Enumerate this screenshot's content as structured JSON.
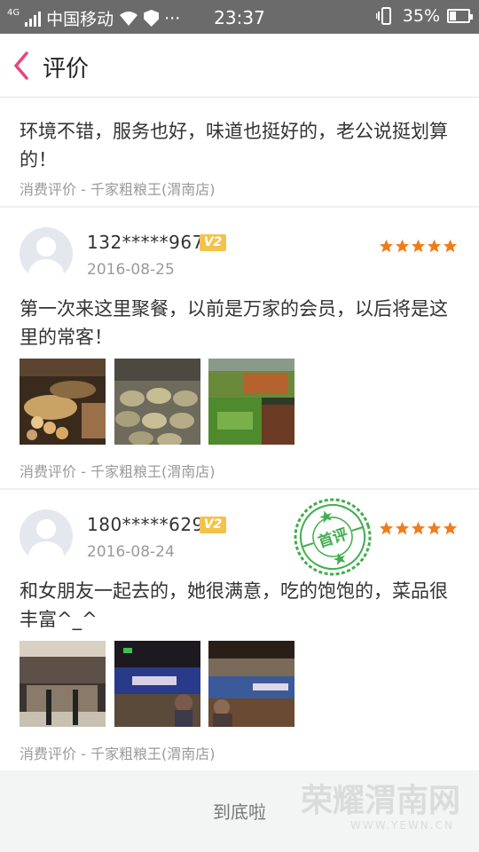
{
  "status_bar": {
    "network": "4G",
    "carrier": "中国移动",
    "more": "···",
    "time": "23:37",
    "battery": "35%",
    "battery_level": 0.35
  },
  "header": {
    "title": "评价"
  },
  "reviews": [
    {
      "content_lines": [
        "环境不错，服务也好，味道也挺好的，老公说挺划算",
        "的！"
      ],
      "meta": "消费评价 - 千家粗粮王(渭南店)"
    },
    {
      "user": "132*****967",
      "vip": "V2",
      "date": "2016-08-25",
      "rating": 5,
      "content_lines": [
        "第一次来这里聚餐，以前是万家的会员，以后将是这",
        "里的常客！"
      ],
      "meta": "消费评价 - 千家粗粮王(渭南店)"
    },
    {
      "user": "180*****629",
      "vip": "V2",
      "date": "2016-08-24",
      "rating": 5,
      "badge": "首评",
      "content_lines": [
        "和女朋友一起去的，她很满意，吃的饱饱的，菜品很",
        "丰富^_^"
      ],
      "meta": "消费评价 - 千家粗粮王(渭南店)"
    }
  ],
  "footer": {
    "text": "到底啦"
  },
  "watermark": {
    "main": "荣耀渭南网",
    "sub": "WWW.YEWN.CN"
  },
  "colors": {
    "accent": "#e8457c",
    "star": "#f07c1c",
    "stamp": "#3fae4d",
    "vip": "#f4c24a"
  }
}
